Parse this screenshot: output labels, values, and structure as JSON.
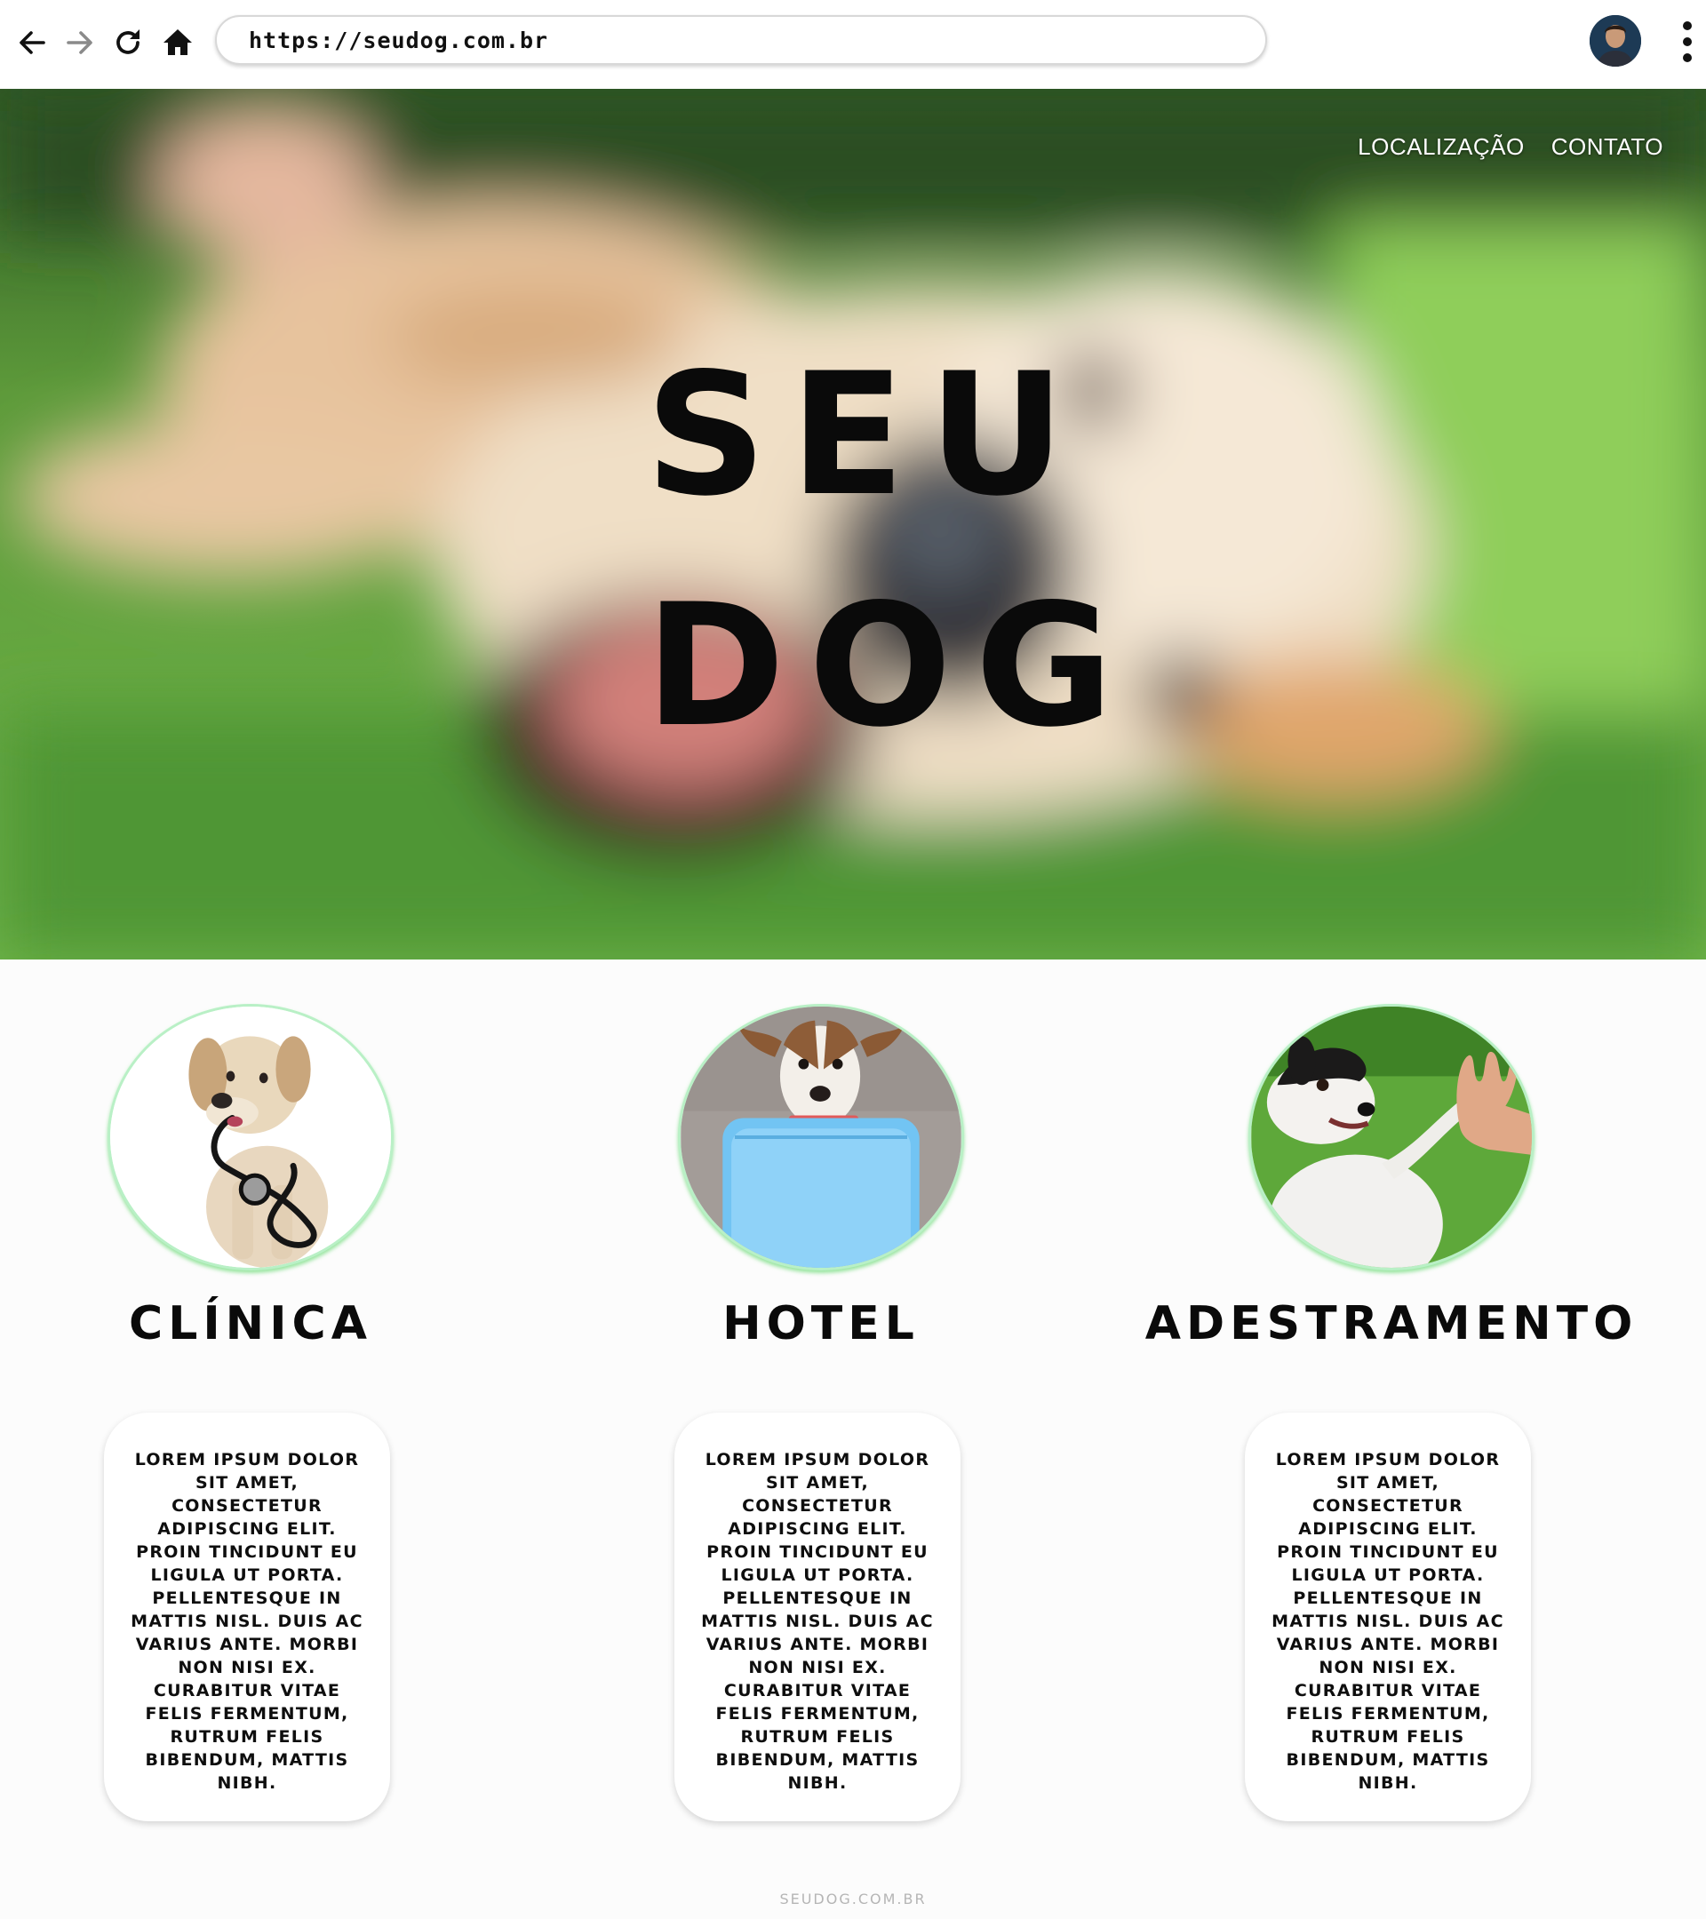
{
  "browser": {
    "url": "https://seudog.com.br"
  },
  "nav": {
    "items": [
      "LOCALIZAÇÃO",
      "CONTATO"
    ]
  },
  "hero": {
    "title_line1": "SEU",
    "title_line2": "DOG"
  },
  "services": [
    {
      "title": "CLÍNICA",
      "text": "Lorem ipsum dolor sit amet, consectetur adipiscing elit. Proin tincidunt eu ligula ut porta. Pellentesque in mattis nisl. Duis ac varius ante. Morbi non nisi ex. Curabitur vitae felis fermentum, rutrum felis bibendum, mattis nibh."
    },
    {
      "title": "HOTEL",
      "text": "Lorem ipsum dolor sit amet, consectetur adipiscing elit. Proin tincidunt eu ligula ut porta. Pellentesque in mattis nisl. Duis ac varius ante. Morbi non nisi ex. Curabitur vitae felis fermentum, rutrum felis bibendum, mattis nibh."
    },
    {
      "title": "ADESTRAMENTO",
      "text": "Lorem ipsum dolor sit amet, consectetur adipiscing elit. Proin tincidunt eu ligula ut porta. Pellentesque in mattis nisl. Duis ac varius ante. Morbi non nisi ex. Curabitur vitae felis fermentum, rutrum felis bibendum, mattis nibh."
    }
  ],
  "footer": {
    "text": "SEUDOG.COM.BR"
  },
  "colors": {
    "circle_border": "#b9f0c6",
    "grass": "#5ea83a",
    "title": "#0a0a0a"
  },
  "icons": [
    "back-arrow-icon",
    "forward-arrow-icon",
    "reload-icon",
    "home-icon",
    "kebab-menu-icon"
  ]
}
